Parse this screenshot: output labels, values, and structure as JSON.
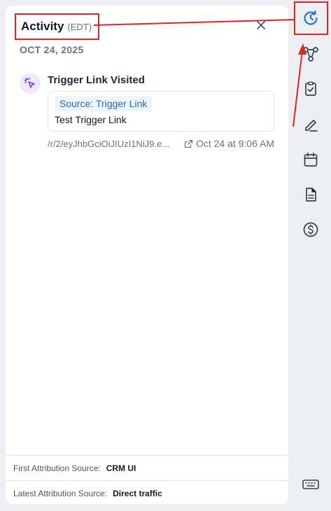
{
  "activity": {
    "title": "Activity",
    "timezone": "(EDT)",
    "date_heading": "OCT 24, 2025"
  },
  "event": {
    "title": "Trigger Link Visited",
    "source_chip": "Source: Trigger Link",
    "card_text": "Test Trigger Link",
    "url": "/r/2/eyJhbGciOiJIUzI1NiJ9.e...",
    "timestamp": "Oct 24 at 9:06 AM",
    "icon": "cursor-click-icon"
  },
  "footer": {
    "first_label": "First Attribution Source:",
    "first_value": "CRM UI",
    "latest_label": "Latest Attribution Source:",
    "latest_value": "Direct traffic"
  },
  "rail": {
    "icons": [
      "history-icon",
      "workflow-icon",
      "task-icon",
      "note-icon",
      "calendar-icon",
      "document-icon",
      "dollar-icon",
      "keyboard-icon"
    ],
    "active": "history-icon"
  },
  "colors": {
    "accent": "#2b6fd6",
    "annotation": "#e02424",
    "event_icon": "#7c3aed"
  }
}
